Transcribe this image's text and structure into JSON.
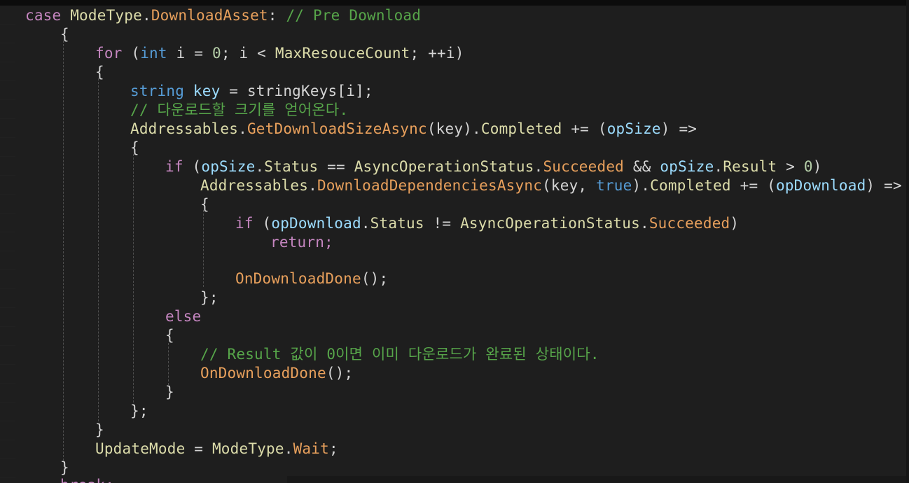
{
  "editor": {
    "language": "csharp",
    "lines": [
      "case ModeType.DownloadAsset: // Pre Download",
      "{",
      "for (int i = 0; i < MaxResouceCount; ++i)",
      "{",
      "string key = stringKeys[i];",
      "// 다운로드할 크기를 얻어온다.",
      "Addressables.GetDownloadSizeAsync(key).Completed += (opSize) =>",
      "{",
      "if (opSize.Status == AsyncOperationStatus.Succeeded && opSize.Result > 0)",
      "Addressables.DownloadDependenciesAsync(key, true).Completed += (opDownload) =>",
      "{",
      "if (opDownload.Status != AsyncOperationStatus.Succeeded)",
      "return;",
      "",
      "OnDownloadDone();",
      "};",
      "else",
      "{",
      "// Result 값이 0이면 이미 다운로드가 완료된 상태이다.",
      "OnDownloadDone();",
      "}",
      "};",
      "}",
      "UpdateMode = ModeType.Wait;",
      "}",
      "break;"
    ]
  },
  "colors": {
    "background": "#1e1e1e",
    "keyword": "#569cd6",
    "control_keyword": "#c586c0",
    "type": "#dcdcaa",
    "member": "#ce9178",
    "comment": "#57a64a",
    "plain": "#d4d4d4"
  }
}
